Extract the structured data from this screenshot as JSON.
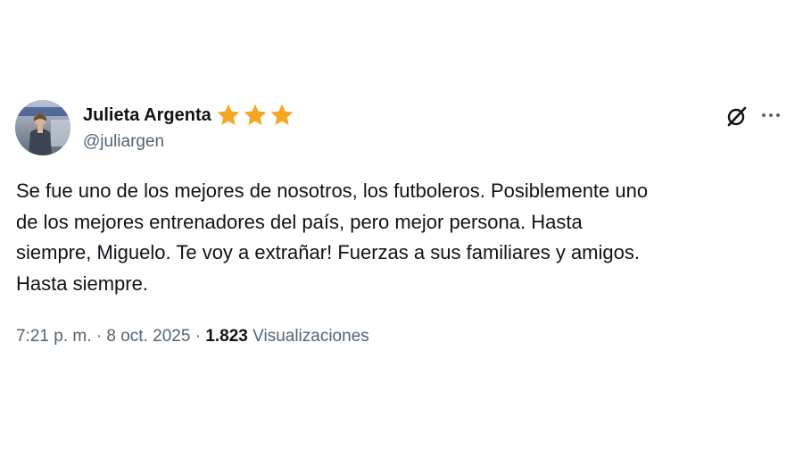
{
  "author": {
    "display_name": "Julieta Argenta",
    "handle": "@juliargen",
    "badge_icon": "star-icon",
    "badge_color": "#f5a623"
  },
  "actions": {
    "grok_icon": "grok-icon",
    "more_icon": "more-icon"
  },
  "tweet": {
    "text": "Se fue uno de los mejores de nosotros, los futboleros. Posiblemente uno\nde los mejores entrenadores del país, pero mejor persona. Hasta\nsiempre, Miguelo. Te voy a extrañar! Fuerzas a sus familiares y amigos.\nHasta siempre."
  },
  "meta": {
    "time": "7:21 p. m.",
    "separator": "·",
    "date": "8 oct. 2025",
    "views_count": "1.823",
    "views_label": "Visualizaciones"
  },
  "colors": {
    "text_primary": "#0f1419",
    "text_secondary": "#536471",
    "background": "#ffffff"
  }
}
